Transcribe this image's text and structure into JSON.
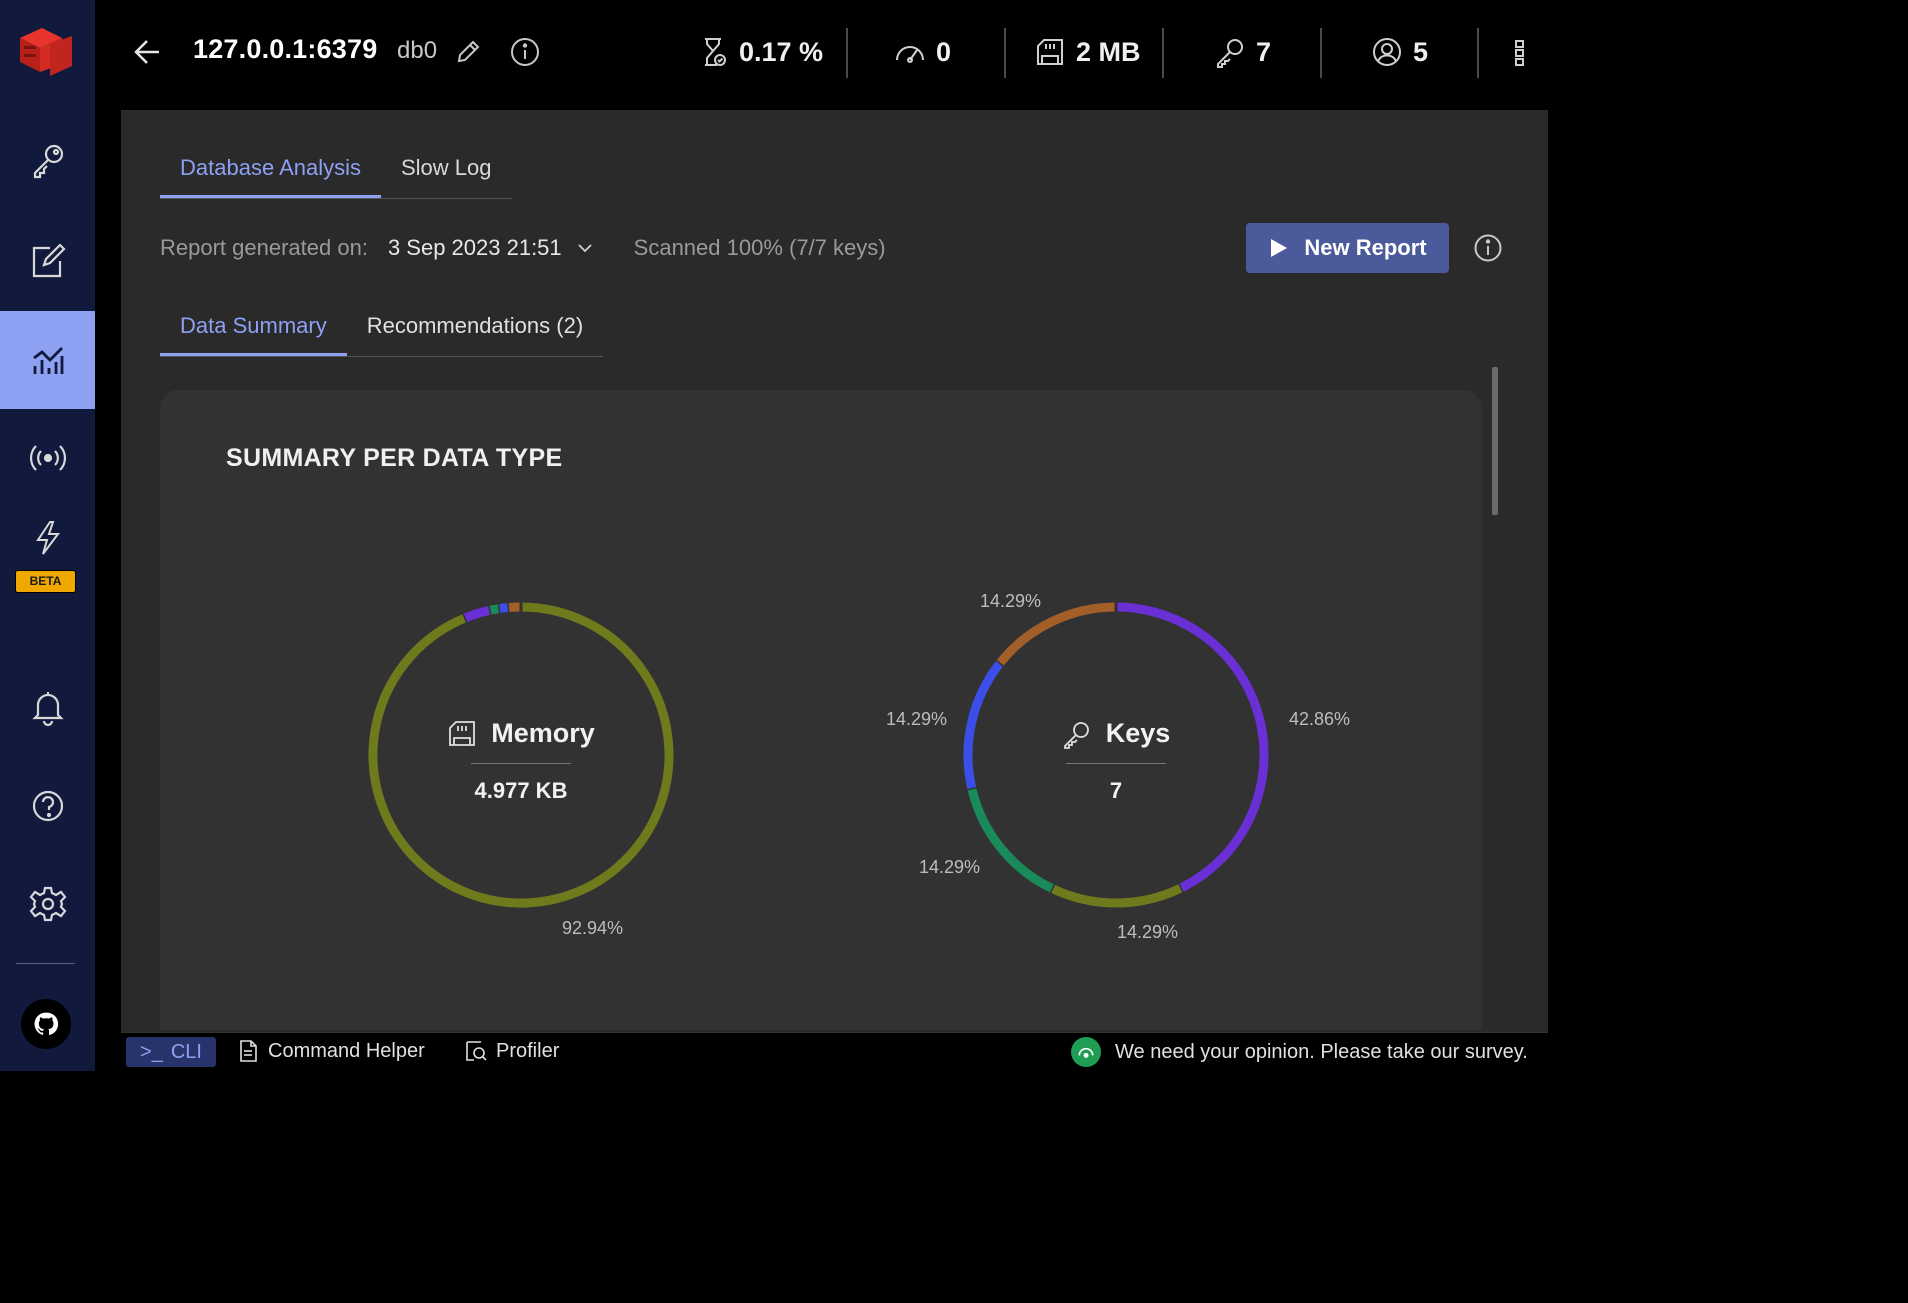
{
  "header": {
    "host": "127.0.0.1:6379",
    "db": "db0",
    "stats": {
      "cpu": "0.17 %",
      "ops": "0",
      "memory": "2 MB",
      "keys": "7",
      "clients": "5"
    }
  },
  "sidebar": {
    "beta_label": "BETA"
  },
  "tabs": [
    "Database Analysis",
    "Slow Log"
  ],
  "report": {
    "label": "Report generated on:",
    "date": "3 Sep 2023 21:51",
    "scanned": "Scanned 100% (7/7 keys)",
    "new_report_label": "New Report"
  },
  "subtabs": [
    "Data Summary",
    "Recommendations (2)"
  ],
  "summary": {
    "title": "SUMMARY PER DATA TYPE",
    "memory": {
      "label": "Memory",
      "value": "4.977 KB",
      "percent_labels": [
        "92.94%"
      ],
      "segments": [
        {
          "value": 92.94,
          "color": "#6e7a1c"
        },
        {
          "value": 2.8,
          "color": "#6b2fd6"
        },
        {
          "value": 1.0,
          "color": "#1a8a5a"
        },
        {
          "value": 1.0,
          "color": "#3b4fe8"
        },
        {
          "value": 1.26,
          "color": "#a35f28"
        }
      ]
    },
    "keys": {
      "label": "Keys",
      "value": "7",
      "percent_labels": [
        "14.29%",
        "14.29%",
        "42.86%",
        "14.29%",
        "14.29%"
      ],
      "segments": [
        {
          "value": 42.86,
          "color": "#6b2fd6"
        },
        {
          "value": 14.29,
          "color": "#6e7a1c"
        },
        {
          "value": 14.29,
          "color": "#1a8a5a"
        },
        {
          "value": 14.29,
          "color": "#3b4fe8"
        },
        {
          "value": 14.29,
          "color": "#a35f28"
        }
      ]
    }
  },
  "bottom": {
    "cli": "CLI",
    "command_helper": "Command Helper",
    "profiler": "Profiler",
    "survey": "We need your opinion. Please take our survey."
  },
  "colors": {
    "accent": "#8ea0f2",
    "sidebar_bg": "#111a3c",
    "button_bg": "#4a5a9a"
  }
}
